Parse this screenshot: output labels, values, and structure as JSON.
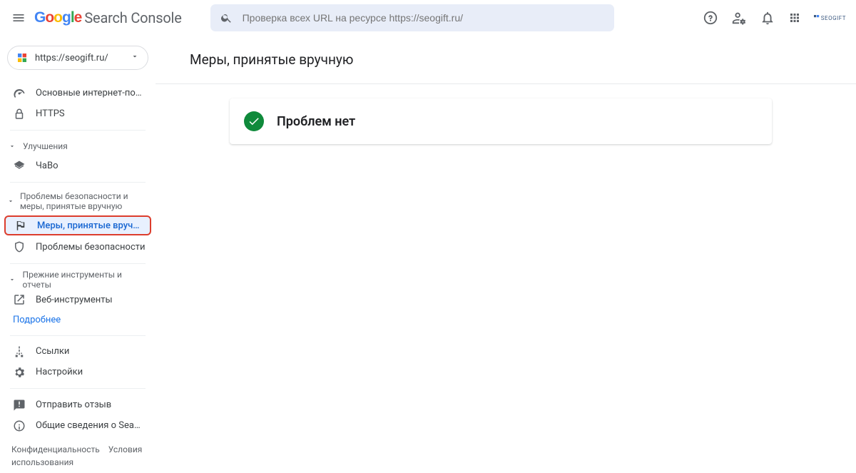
{
  "header": {
    "product_name": "Search Console",
    "google_letters": [
      "G",
      "o",
      "o",
      "g",
      "l",
      "e"
    ],
    "search_placeholder": "Проверка всех URL на ресурсе https://seogift.ru/"
  },
  "brand_watermark": "SEOGIFT",
  "property": {
    "url": "https://seogift.ru/"
  },
  "sidebar": {
    "core_web_vitals": "Основные интернет-по…",
    "https": "HTTPS",
    "enhancements_header": "Улучшения",
    "faq": "ЧаВо",
    "security_header": "Проблемы безопасности и меры, принятые вручную",
    "manual_actions": "Меры, принятые вручн…",
    "security_issues": "Проблемы безопасности",
    "legacy_header": "Прежние инструменты и отчеты",
    "web_tools": "Веб-инструменты",
    "more": "Подробнее",
    "links": "Ссылки",
    "settings": "Настройки",
    "feedback": "Отправить отзыв",
    "about": "Общие сведения о Sea…"
  },
  "footer": {
    "privacy": "Конфиденциальность",
    "terms": "Условия использования"
  },
  "page": {
    "title": "Меры, принятые вручную",
    "card_text": "Проблем нет"
  }
}
